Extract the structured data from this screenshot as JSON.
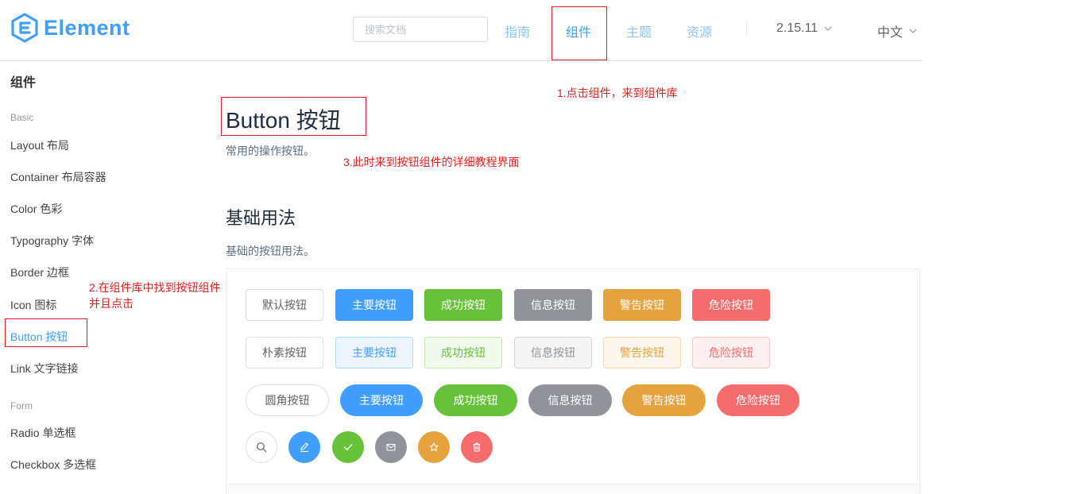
{
  "header": {
    "logo_text": "Element",
    "search_placeholder": "搜索文档",
    "nav": [
      "指南",
      "组件",
      "主题",
      "资源"
    ],
    "version": "2.15.11",
    "language": "中文"
  },
  "sidebar": {
    "title": "组件",
    "group_basic": "Basic",
    "items_basic": [
      "Layout 布局",
      "Container 布局容器",
      "Color 色彩",
      "Typography 字体",
      "Border 边框",
      "Icon 图标",
      "Button 按钮",
      "Link 文字链接"
    ],
    "group_form": "Form",
    "items_form": [
      "Radio 单选框",
      "Checkbox 多选框"
    ]
  },
  "main": {
    "title": "Button 按钮",
    "desc": "常用的操作按钮。",
    "section_title": "基础用法",
    "section_desc": "基础的按钮用法。",
    "row1": [
      "默认按钮",
      "主要按钮",
      "成功按钮",
      "信息按钮",
      "警告按钮",
      "危险按钮"
    ],
    "row2": [
      "朴素按钮",
      "主要按钮",
      "成功按钮",
      "信息按钮",
      "警告按钮",
      "危险按钮"
    ],
    "row3": [
      "圆角按钮",
      "主要按钮",
      "成功按钮",
      "信息按钮",
      "警告按钮",
      "危险按钮"
    ],
    "icon_buttons": [
      "search-icon",
      "edit-icon",
      "check-icon",
      "message-icon",
      "star-icon",
      "delete-icon"
    ]
  },
  "annotations": {
    "step1": "1.点击组件，来到组件库",
    "step2_line1": "2.在组件库中找到按钮组件",
    "step2_line2": "并且点击",
    "step3": "3.此时来到按钮组件的详细教程界面"
  },
  "colors": {
    "primary": "#409eff",
    "success": "#67c23a",
    "info": "#909399",
    "warning": "#e6a23c",
    "danger": "#f56c6c",
    "annotation": "#e02020"
  }
}
